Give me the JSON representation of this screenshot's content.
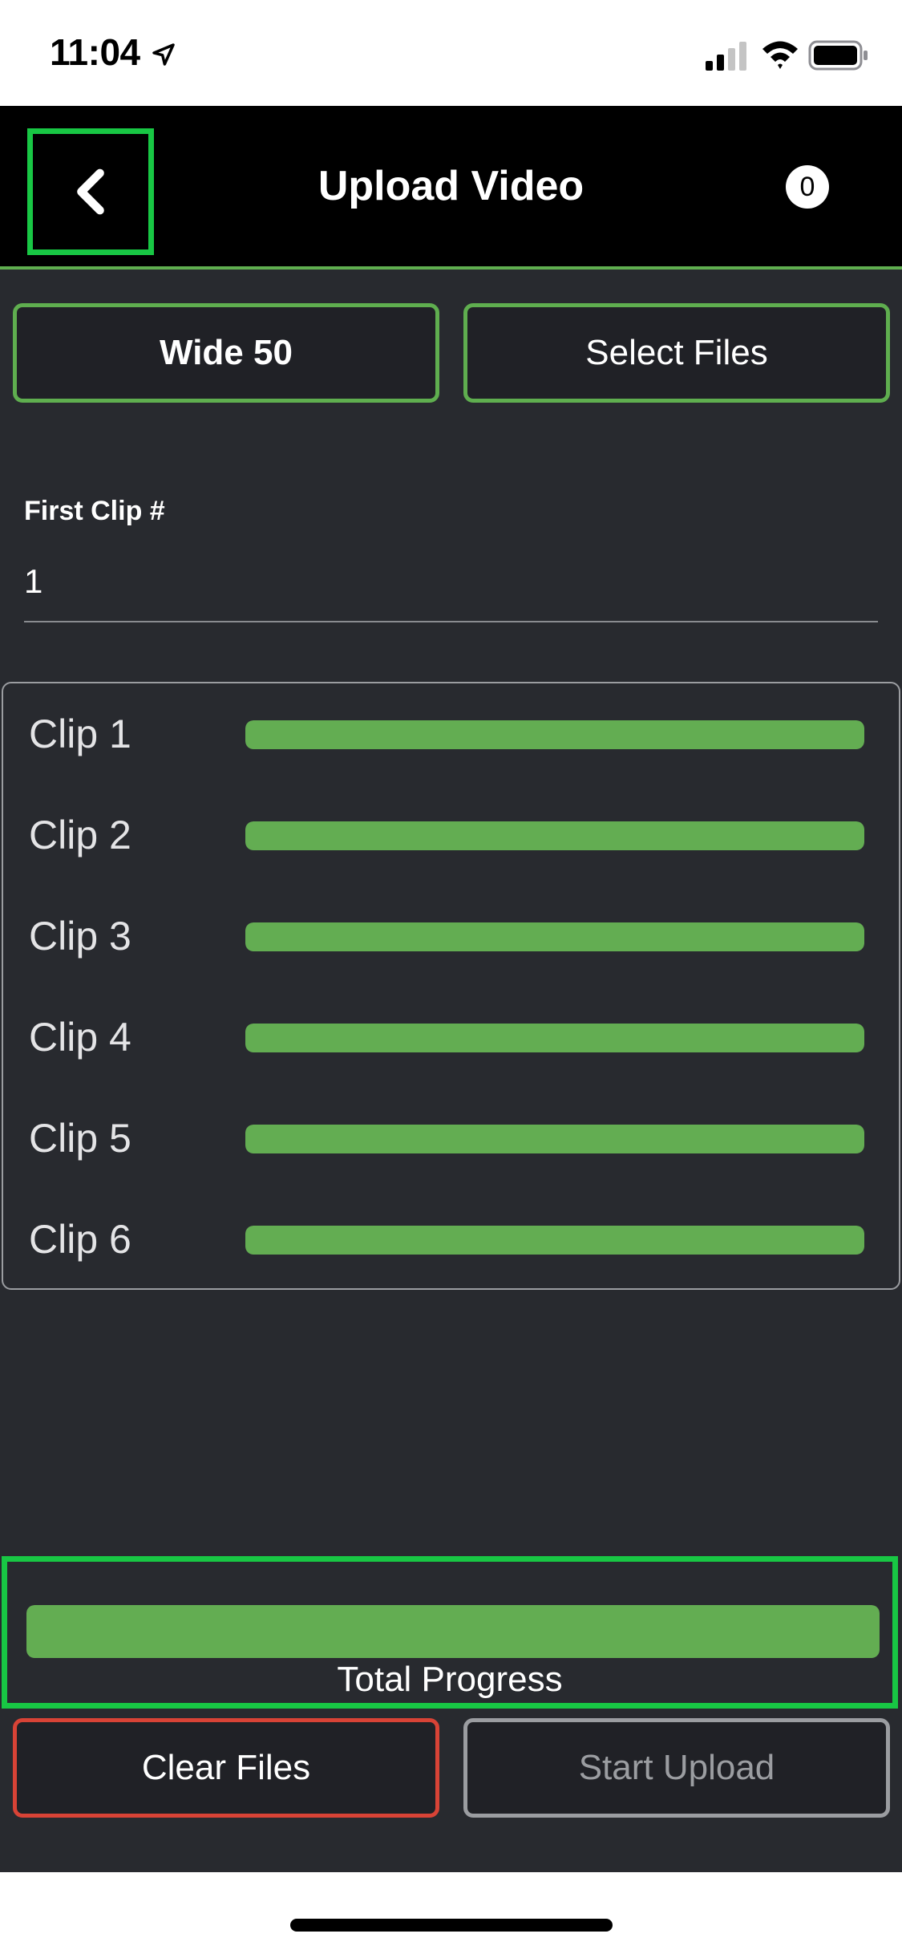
{
  "status_bar": {
    "time": "11:04",
    "icons": [
      "location-arrow-icon",
      "cellular-signal-icon",
      "wifi-icon",
      "battery-icon"
    ]
  },
  "header": {
    "title": "Upload Video",
    "back_icon": "chevron-left-icon",
    "badge_count": "0"
  },
  "actions": {
    "camera_label": "Wide 50",
    "select_files_label": "Select Files",
    "clear_files_label": "Clear Files",
    "start_upload_label": "Start Upload"
  },
  "first_clip": {
    "label": "First Clip #",
    "value": "1"
  },
  "clips": [
    {
      "name": "Clip 1",
      "progress": 1.0
    },
    {
      "name": "Clip 2",
      "progress": 1.0
    },
    {
      "name": "Clip 3",
      "progress": 1.0
    },
    {
      "name": "Clip 4",
      "progress": 1.0
    },
    {
      "name": "Clip 5",
      "progress": 1.0
    },
    {
      "name": "Clip 6",
      "progress": 1.0
    }
  ],
  "total": {
    "label": "Total Progress",
    "progress": 1.0
  },
  "colors": {
    "accent_green": "#5fae4f",
    "highlight_green": "#18c744",
    "progress_green": "#63ad52",
    "danger_red": "#d84336",
    "disabled_gray": "#9b9da1",
    "background": "#282a2f",
    "header_background": "#000000"
  }
}
